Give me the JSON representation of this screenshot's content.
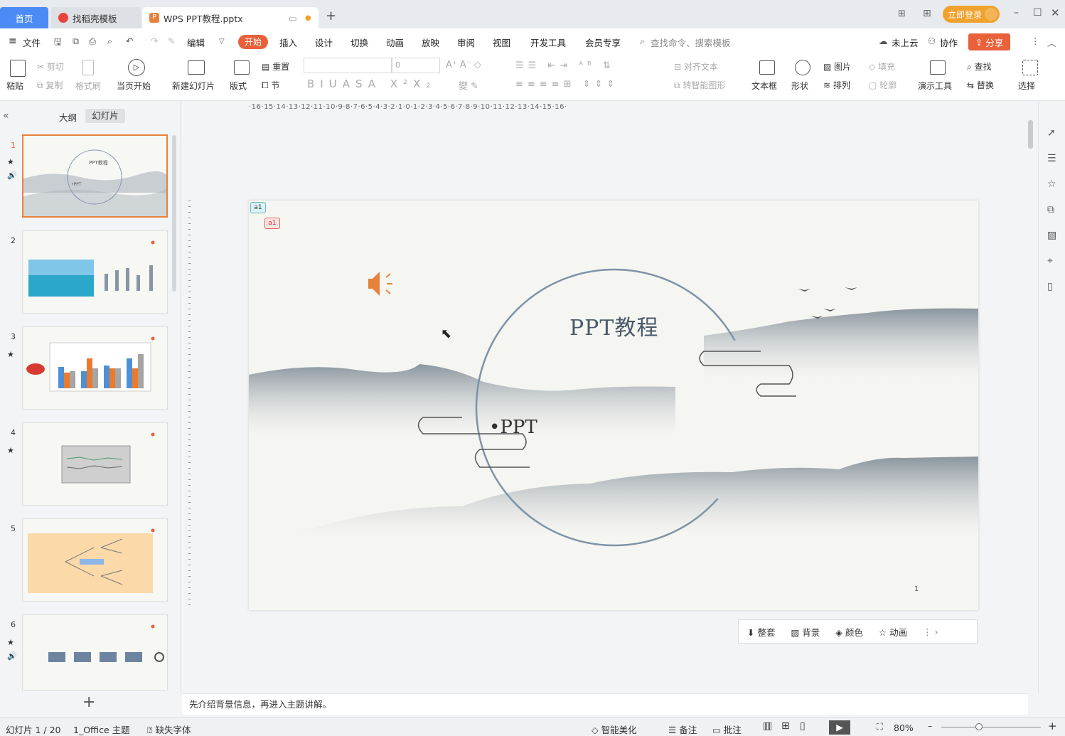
{
  "tabs": {
    "home": "首页",
    "docer": "找稻壳模板",
    "doc": "WPS PPT教程.pptx"
  },
  "titlebar": {
    "login": "立即登录"
  },
  "menus": [
    "文件",
    "开始",
    "插入",
    "设计",
    "切换",
    "动画",
    "放映",
    "审阅",
    "视图",
    "开发工具",
    "会员专享"
  ],
  "menubar": {
    "edit": "编辑",
    "search_placeholder": "查找命令、搜索模板",
    "cloud": "未上云",
    "collab": "协作",
    "share": "分享"
  },
  "ribbon": {
    "paste": "粘贴",
    "cut": "剪切",
    "copy": "复制",
    "format_painter": "格式刷",
    "from_current": "当页开始",
    "new_slide": "新建幻灯片",
    "layout": "版式",
    "reset": "重置",
    "section": "节",
    "font_size": "0",
    "align_text": "对齐文本",
    "smart_graphic": "转智能图形",
    "textbox": "文本框",
    "shape": "形状",
    "picture": "图片",
    "arrange": "排列",
    "fill": "填充",
    "outline": "轮廓",
    "presenter_tools": "演示工具",
    "find": "查找",
    "replace": "替换",
    "select": "选择"
  },
  "panel": {
    "outline_tab": "大纲",
    "slides_tab": "幻灯片",
    "slide_numbers": [
      "1",
      "2",
      "3",
      "4",
      "5",
      "6"
    ]
  },
  "slide": {
    "title": "PPT教程",
    "subtitle": "•PPT",
    "page_number": "1",
    "comment_a": "a1",
    "comment_b": "a1"
  },
  "ruler": {
    "h": "·16·15·14·13·12·11·10·9·8·7·6·5·4·3·2·1·0·1·2·3·4·5·6·7·8·9·10·11·12·13·14·15·16·"
  },
  "slidetools": {
    "theme": "整套",
    "background": "背景",
    "color": "颜色",
    "animation": "动画"
  },
  "notes": "先介绍背景信息，再进入主题讲解。",
  "status": {
    "slide_count": "幻灯片 1 / 20",
    "theme": "1_Office 主题",
    "missing_fonts": "缺失字体",
    "beautify": "智能美化",
    "notes": "备注",
    "comments": "批注",
    "zoom": "80%"
  },
  "colors": {
    "accent": "#e8613a",
    "tab_blue": "#4c8bf5",
    "login": "#f0a22d",
    "circle": "#7d93a8"
  }
}
